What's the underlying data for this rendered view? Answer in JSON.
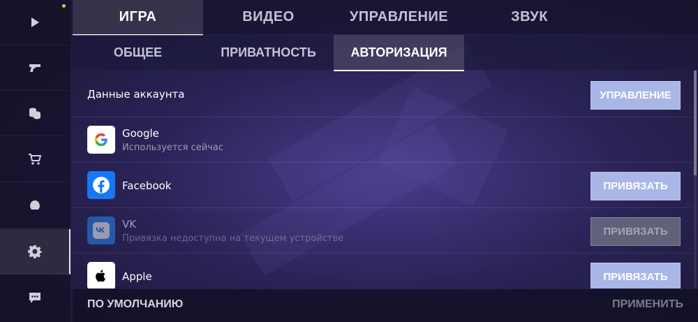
{
  "sidebar": {
    "items": [
      {
        "icon": "play-icon"
      },
      {
        "icon": "pistol-icon"
      },
      {
        "icon": "coins-icon"
      },
      {
        "icon": "cart-icon"
      },
      {
        "icon": "helmet-icon"
      },
      {
        "icon": "gear-icon",
        "active": true
      },
      {
        "icon": "chat-icon"
      }
    ],
    "notification_color": "#f0c040"
  },
  "top_tabs": [
    {
      "label": "ИГРА",
      "active": true
    },
    {
      "label": "ВИДЕО"
    },
    {
      "label": "УПРАВЛЕНИЕ"
    },
    {
      "label": "ЗВУК"
    }
  ],
  "sub_tabs": [
    {
      "label": "ОБЩЕЕ"
    },
    {
      "label": "ПРИВАТНОСТЬ"
    },
    {
      "label": "АВТОРИЗАЦИЯ",
      "active": true
    }
  ],
  "account": {
    "title": "Данные аккаунта",
    "button_label": "УПРАВЛЕНИЕ"
  },
  "providers": [
    {
      "name": "Google",
      "status": "Используется сейчас",
      "icon": "google-logo-icon"
    },
    {
      "name": "Facebook",
      "button_label": "ПРИВЯЗАТЬ",
      "icon": "facebook-logo-icon",
      "color": "#1877f2"
    },
    {
      "name": "VK",
      "status": "Привязка недоступна на текущем устройстве",
      "button_label": "ПРИВЯЗАТЬ",
      "icon": "vk-logo-icon",
      "color": "#2787f5",
      "disabled": true
    },
    {
      "name": "Apple",
      "button_label": "ПРИВЯЗАТЬ",
      "icon": "apple-logo-icon"
    }
  ],
  "footer": {
    "reset_label": "ПО УМОЛЧАНИЮ",
    "apply_label": "ПРИМЕНИТЬ"
  },
  "colors": {
    "button": "#a9b6e6",
    "button_disabled": "#5f627a"
  }
}
